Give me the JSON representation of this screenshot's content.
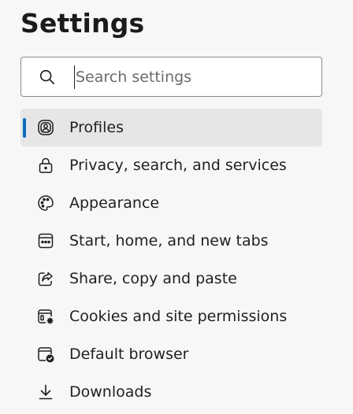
{
  "page": {
    "title": "Settings"
  },
  "search": {
    "placeholder": "Search settings",
    "value": "",
    "icon": "search-icon"
  },
  "nav": {
    "accent_color": "#0f6cbd",
    "items": [
      {
        "label": "Profiles",
        "icon": "profile-icon",
        "active": true
      },
      {
        "label": "Privacy, search, and services",
        "icon": "lock-icon",
        "active": false
      },
      {
        "label": "Appearance",
        "icon": "palette-icon",
        "active": false
      },
      {
        "label": "Start, home, and new tabs",
        "icon": "home-tabs-icon",
        "active": false
      },
      {
        "label": "Share, copy and paste",
        "icon": "share-icon",
        "active": false
      },
      {
        "label": "Cookies and site permissions",
        "icon": "cookies-permissions-icon",
        "active": false
      },
      {
        "label": "Default browser",
        "icon": "default-browser-icon",
        "active": false
      },
      {
        "label": "Downloads",
        "icon": "download-icon",
        "active": false
      }
    ]
  }
}
